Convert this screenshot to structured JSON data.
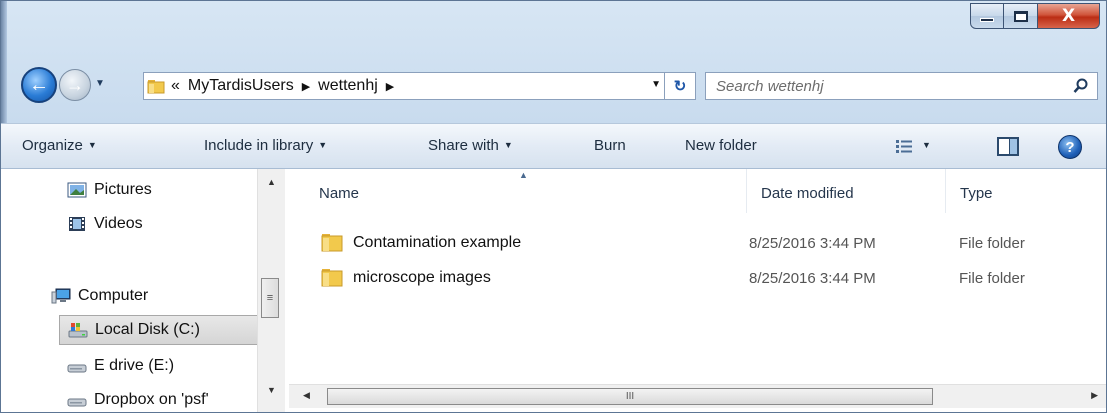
{
  "window": {
    "minimize_label": "",
    "maximize_label": "",
    "close_label": "X"
  },
  "nav": {
    "back_glyph": "←",
    "forward_glyph": "→"
  },
  "address": {
    "crumb_overflow": "«",
    "crumbs": [
      "MyTardisUsers",
      "wettenhj"
    ],
    "separator": "▶",
    "refresh_glyph": "↻"
  },
  "search": {
    "placeholder": "Search wettenhj"
  },
  "toolbar": {
    "organize": "Organize",
    "include_in_library": "Include in library",
    "share_with": "Share with",
    "burn": "Burn",
    "new_folder": "New folder",
    "help_glyph": "?"
  },
  "sidebar": {
    "items": [
      {
        "label": "Pictures",
        "icon": "pictures-icon"
      },
      {
        "label": "Videos",
        "icon": "videos-icon"
      },
      {
        "label": "Computer",
        "icon": "computer-icon"
      },
      {
        "label": "Local Disk (C:)",
        "icon": "local-disk-icon"
      },
      {
        "label": "E drive (E:)",
        "icon": "drive-icon"
      },
      {
        "label": "Dropbox on 'psf'",
        "icon": "drive-icon"
      }
    ],
    "selected": "Local Disk (C:)"
  },
  "files": {
    "columns": [
      "Name",
      "Date modified",
      "Type"
    ],
    "rows": [
      {
        "name": "Contamination example",
        "date": "8/25/2016 3:44 PM",
        "type": "File folder"
      },
      {
        "name": "microscope images",
        "date": "8/25/2016 3:44 PM",
        "type": "File folder"
      }
    ]
  },
  "scrollbars": {
    "grip": "III",
    "vgrip": "≡"
  },
  "colors": {
    "title_gradient": "#c3d7ec",
    "close_red": "#bb2d14",
    "folder_yellow": "#f2c94c"
  }
}
